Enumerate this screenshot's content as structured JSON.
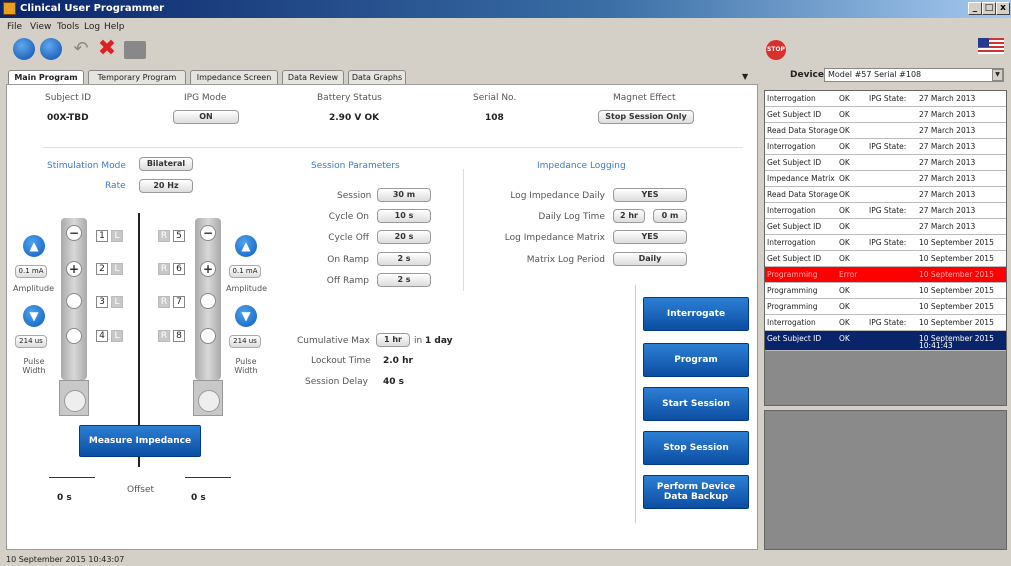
{
  "window": {
    "title": "Clinical User Programmer",
    "min": "_",
    "max": "□",
    "close": "x"
  },
  "menu": [
    "File",
    "View",
    "Tools",
    "Log",
    "Help"
  ],
  "tabs": [
    {
      "label": "Main Program"
    },
    {
      "label": "Temporary Program"
    },
    {
      "label": "Impedance Screen"
    },
    {
      "label": "Data Review"
    },
    {
      "label": "Data Graphs"
    }
  ],
  "header": {
    "subject_id_label": "Subject ID",
    "subject_id": "00X-TBD",
    "ipg_mode_label": "IPG Mode",
    "ipg_mode": "ON",
    "battery_label": "Battery Status",
    "battery": "2.90 V  OK",
    "serial_label": "Serial No.",
    "serial": "108",
    "magnet_label": "Magnet Effect",
    "magnet": "Stop Session Only"
  },
  "stim": {
    "mode_label": "Stimulation Mode",
    "mode": "Bilateral",
    "rate_label": "Rate",
    "rate": "20 Hz"
  },
  "session": {
    "title": "Session Parameters",
    "items": [
      {
        "label": "Session",
        "value": "30 m"
      },
      {
        "label": "Cycle On",
        "value": "10 s"
      },
      {
        "label": "Cycle Off",
        "value": "20 s"
      },
      {
        "label": "On Ramp",
        "value": "2 s"
      },
      {
        "label": "Off Ramp",
        "value": "2 s"
      }
    ],
    "cum_label": "Cumulative Max",
    "cum_value": "1 hr",
    "cum_in": "in",
    "cum_period": "1 day",
    "lockout_label": "Lockout Time",
    "lockout": "2.0 hr",
    "delay_label": "Session Delay",
    "delay": "40 s"
  },
  "impedance": {
    "title": "Impedance Logging",
    "daily_label": "Log Impedance Daily",
    "daily": "YES",
    "time_label": "Daily Log Time",
    "time_h": "2 hr",
    "time_m": "0 m",
    "matrix_label": "Log Impedance Matrix",
    "matrix": "YES",
    "period_label": "Matrix Log Period",
    "period": "Daily"
  },
  "electrodes": {
    "left": [
      {
        "n": "1",
        "l": "L"
      },
      {
        "n": "2",
        "l": "L"
      },
      {
        "n": "3",
        "l": "L"
      },
      {
        "n": "4",
        "l": "L"
      }
    ],
    "right": [
      {
        "r": "R",
        "n": "5"
      },
      {
        "r": "R",
        "n": "6"
      },
      {
        "r": "R",
        "n": "7"
      },
      {
        "r": "R",
        "n": "8"
      }
    ],
    "amp_left": "0.1 mA",
    "amp_right": "0.1 mA",
    "amp_label": "Amplitude",
    "pw_left": "214 us",
    "pw_right": "214 us",
    "pw_label": "Pulse Width",
    "offset_label": "Offset",
    "offset_left": "0 s",
    "offset_right": "0 s"
  },
  "buttons": {
    "measure": "Measure Impedance",
    "interrogate": "Interrogate",
    "program": "Program",
    "start": "Start Session",
    "stop": "Stop Session",
    "backup": "Perform Device Data Backup"
  },
  "device": {
    "label": "Device:",
    "value": "Model #57 Serial #108"
  },
  "log": [
    {
      "op": "Interrogation",
      "res": "OK",
      "extra": "IPG State:",
      "date": "27 March 2013"
    },
    {
      "op": "Get Subject ID",
      "res": "OK",
      "extra": "",
      "date": "27 March 2013"
    },
    {
      "op": "Read Data Storage",
      "res": "OK",
      "extra": "",
      "date": "27 March 2013"
    },
    {
      "op": "Interrogation",
      "res": "OK",
      "extra": "IPG State:",
      "date": "27 March 2013"
    },
    {
      "op": "Get Subject ID",
      "res": "OK",
      "extra": "",
      "date": "27 March 2013"
    },
    {
      "op": "Impedance Matrix",
      "res": "OK",
      "extra": "",
      "date": "27 March 2013"
    },
    {
      "op": "Read Data Storage",
      "res": "OK",
      "extra": "",
      "date": "27 March 2013"
    },
    {
      "op": "Interrogation",
      "res": "OK",
      "extra": "IPG State:",
      "date": "27 March 2013"
    },
    {
      "op": "Get Subject ID",
      "res": "OK",
      "extra": "",
      "date": "27 March 2013"
    },
    {
      "op": "Interrogation",
      "res": "OK",
      "extra": "IPG State:",
      "date": "10 September 2015"
    },
    {
      "op": "Get Subject ID",
      "res": "OK",
      "extra": "",
      "date": "10 September 2015"
    },
    {
      "op": "Programming",
      "res": "Error",
      "extra": "",
      "date": "10 September 2015"
    },
    {
      "op": "Programming",
      "res": "OK",
      "extra": "",
      "date": "10 September 2015"
    },
    {
      "op": "Programming",
      "res": "OK",
      "extra": "",
      "date": "10 September 2015"
    },
    {
      "op": "Interrogation",
      "res": "OK",
      "extra": "IPG State:",
      "date": "10 September 2015"
    },
    {
      "op": "Get Subject ID",
      "res": "OK",
      "extra": "",
      "date": "10 September 2015",
      "time": "10:41:43"
    }
  ],
  "status": "10 September 2015 10:43:07",
  "stop_sign": "STOP",
  "colors": {
    "accent": "#0b4ea2",
    "error": "#ff0000",
    "selected": "#0a246a"
  }
}
